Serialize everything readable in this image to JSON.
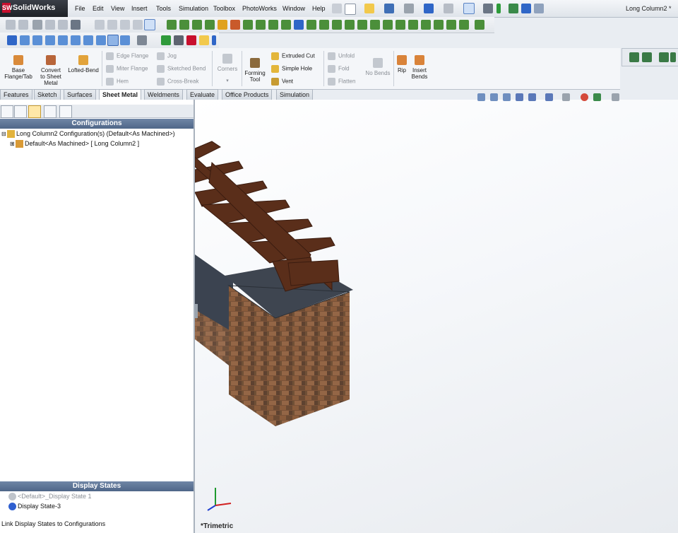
{
  "app": {
    "brand": "SolidWorks",
    "logo_letters": "SW"
  },
  "menu": [
    "File",
    "Edit",
    "View",
    "Insert",
    "Tools",
    "Simulation",
    "Toolbox",
    "PhotoWorks",
    "Window",
    "Help"
  ],
  "document_title": "Long Column2 *",
  "command_manager": {
    "big_buttons": [
      {
        "label": "Base\nFlange/Tab"
      },
      {
        "label": "Convert\nto Sheet\nMetal"
      },
      {
        "label": "Lofted-Bend"
      },
      {
        "label": "Corners"
      },
      {
        "label": "Forming\nTool"
      },
      {
        "label": "No Bends"
      },
      {
        "label": "Rip"
      },
      {
        "label": "Insert\nBends"
      }
    ],
    "small_buttons": {
      "edge_flange": "Edge Flange",
      "miter_flange": "Miter Flange",
      "hem": "Hem",
      "jog": "Jog",
      "sketched_bend": "Sketched Bend",
      "cross_break": "Cross-Break",
      "extruded_cut": "Extruded Cut",
      "simple_hole": "Simple Hole",
      "vent": "Vent",
      "unfold": "Unfold",
      "fold": "Fold",
      "flatten": "Flatten"
    }
  },
  "tabs": [
    {
      "label": "Features",
      "active": false
    },
    {
      "label": "Sketch",
      "active": false
    },
    {
      "label": "Surfaces",
      "active": false
    },
    {
      "label": "Sheet Metal",
      "active": true
    },
    {
      "label": "Weldments",
      "active": false
    },
    {
      "label": "Evaluate",
      "active": false
    },
    {
      "label": "Office Products",
      "active": false
    },
    {
      "label": "Simulation",
      "active": false
    }
  ],
  "configurations": {
    "header": "Configurations",
    "root": "Long Column2 Configuration(s)  (Default<As Machined>)",
    "child": "Default<As Machined> [ Long Column2 ]"
  },
  "display_states": {
    "header": "Display States",
    "items": [
      {
        "label": "<Default>_Display State 1",
        "active": false
      },
      {
        "label": "Display State-3",
        "active": true
      }
    ],
    "link_label": "Link Display States to Configurations"
  },
  "viewport": {
    "view_name": "*Trimetric"
  },
  "colors": {
    "header_blue": "#5a7194",
    "accent_red": "#c8102e",
    "active_tab": "#ffffff"
  }
}
